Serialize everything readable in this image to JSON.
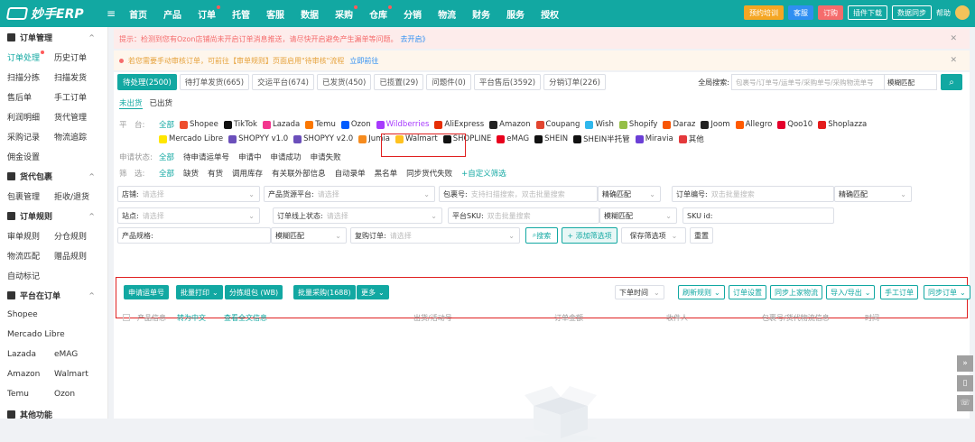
{
  "app": {
    "name": "妙手ERP"
  },
  "nav": [
    "首页",
    "产品",
    "订单",
    "托管",
    "客服",
    "数据",
    "采购",
    "仓库",
    "分销",
    "物流",
    "财务",
    "服务",
    "授权"
  ],
  "top_right": {
    "training": "预约培训",
    "cs": "客服",
    "order": "订购",
    "plugin": "插件下载",
    "sync": "数据同步",
    "help": "帮助"
  },
  "sidebar": {
    "g1": "订单管理",
    "r1": [
      "订单处理",
      "历史订单"
    ],
    "r2": [
      "扫描分拣",
      "扫描发货"
    ],
    "r3": [
      "售后单",
      "手工订单"
    ],
    "r4": [
      "利润明细",
      "货代管理"
    ],
    "r5": [
      "采购记录",
      "物流追踪"
    ],
    "r6": [
      "佣金设置"
    ],
    "g2": "货代包裹",
    "r7": [
      "包裹管理",
      "拒收/退货"
    ],
    "g3": "订单规则",
    "r8": [
      "审单规则",
      "分仓规则"
    ],
    "r9": [
      "物流匹配",
      "赠品规则"
    ],
    "r10": [
      "自动标记"
    ],
    "g4": "平台在订单",
    "r11": [
      "Shopee"
    ],
    "r12": [
      "Mercado Libre"
    ],
    "r13": [
      "Lazada",
      "eMAG"
    ],
    "r14": [
      "Amazon",
      "Walmart"
    ],
    "r15": [
      "Temu",
      "Ozon"
    ],
    "g5": "其他功能"
  },
  "notice1": {
    "text": "提示：检测到您有Ozon店铺尚未开启订单消息推送，请尽快开启避免产生漏单等问题。",
    "link": "去开启》"
  },
  "notice2": {
    "text": "若您需要手动审核订单，可前往【审单规则】页面启用\"待审核\"流程",
    "link": "立即前往"
  },
  "tabs": [
    "待处理(2500)",
    "待打单发货(665)",
    "交运平台(674)",
    "已发货(450)",
    "已揽置(29)",
    "问题件(0)",
    "平台售后(3592)",
    "分销订单(226)"
  ],
  "global_search": {
    "label": "全局搜索:",
    "placeholder": "包裹号/订单号/运单号/采购单号/采购物流单号",
    "mode": "模糊匹配"
  },
  "subtabs": [
    "未出货",
    "已出货"
  ],
  "platform": {
    "label": "平　台:",
    "all": "全部"
  },
  "platforms_row1": [
    {
      "name": "Shopee",
      "color": "#ee4d2d"
    },
    {
      "name": "TikTok",
      "color": "#111111"
    },
    {
      "name": "Lazada",
      "color": "#f3368e"
    },
    {
      "name": "Temu",
      "color": "#fb7701"
    },
    {
      "name": "Ozon",
      "color": "#005bff"
    },
    {
      "name": "Wildberries",
      "color": "#a73afd"
    },
    {
      "name": "AliExpress",
      "color": "#e62e04"
    },
    {
      "name": "Amazon",
      "color": "#222222"
    },
    {
      "name": "Coupang",
      "color": "#e2452f"
    },
    {
      "name": "Wish",
      "color": "#2fb7ec"
    },
    {
      "name": "Shopify",
      "color": "#95bf47"
    },
    {
      "name": "Daraz",
      "color": "#f85606"
    },
    {
      "name": "Joom",
      "color": "#222222"
    },
    {
      "name": "Allegro",
      "color": "#ff5a00"
    },
    {
      "name": "Qoo10",
      "color": "#e4002b"
    },
    {
      "name": "Shoplazza",
      "color": "#e41c1c"
    }
  ],
  "platforms_row2": [
    {
      "name": "Mercado Libre",
      "color": "#ffe600"
    },
    {
      "name": "SHOPYY v1.0",
      "color": "#6b4fbb"
    },
    {
      "name": "SHOPYY v2.0",
      "color": "#6b4fbb"
    },
    {
      "name": "Jumia",
      "color": "#f68b1e"
    },
    {
      "name": "Walmart",
      "color": "#ffc220"
    },
    {
      "name": "SHOPLINE",
      "color": "#111111"
    },
    {
      "name": "eMAG",
      "color": "#e8001c"
    },
    {
      "name": "SHEIN",
      "color": "#111111"
    },
    {
      "name": "SHEIN半托管",
      "color": "#111111"
    },
    {
      "name": "Miravia",
      "color": "#6b3fd6"
    },
    {
      "name": "其他",
      "color": "#e4393c"
    }
  ],
  "apply_status": {
    "label": "申请状态:",
    "items": [
      "全部",
      "待申请运单号",
      "申请中",
      "申请成功",
      "申请失败"
    ]
  },
  "filter": {
    "label": "筛　选:",
    "items": [
      "全部",
      "缺货",
      "有货",
      "调用库存",
      "有关联外部信息",
      "自动录单",
      "黑名单",
      "同步货代失败"
    ],
    "add": "+自定义筛选"
  },
  "fields": {
    "store": {
      "label": "店铺:",
      "ph": "请选择"
    },
    "source": {
      "label": "产品货源平台:",
      "ph": "请选择"
    },
    "package": {
      "label": "包裹号:",
      "ph": "支持扫描搜索，双击批量搜索",
      "mode": "精确匹配"
    },
    "order_no": {
      "label": "订单编号:",
      "ph": "双击批量搜索",
      "mode": "精确匹配"
    },
    "site": {
      "label": "站点:",
      "ph": "请选择"
    },
    "online_status": {
      "label": "订单线上状态:",
      "ph": "请选择"
    },
    "sku": {
      "label": "平台SKU:",
      "ph": "双击批量搜索",
      "mode": "模糊匹配"
    },
    "sku_id": {
      "label": "SKU id:"
    },
    "spec": {
      "label": "产品规格:",
      "mode": "模糊匹配"
    },
    "repurchase": {
      "label": "复购订单:",
      "ph": "请选择"
    },
    "search": "搜索",
    "add_filter": "+ 添加筛选项",
    "save_filter": "保存筛选项",
    "reset": "重置"
  },
  "actions_left": [
    "申请运单号",
    "批量打印",
    "分拣组包 (WB)",
    "批量采购(1688)",
    "更多"
  ],
  "actions_right": [
    "下单时间",
    "刷新规则",
    "订单设置",
    "同步上家物流",
    "导入/导出",
    "手工订单",
    "同步订单"
  ],
  "table_headers": [
    "产品信息",
    "转为中文",
    "查看全文信息",
    "出货/活动号",
    "订单金额",
    "收件人",
    "包裹号/货代物流信息",
    "时间"
  ]
}
